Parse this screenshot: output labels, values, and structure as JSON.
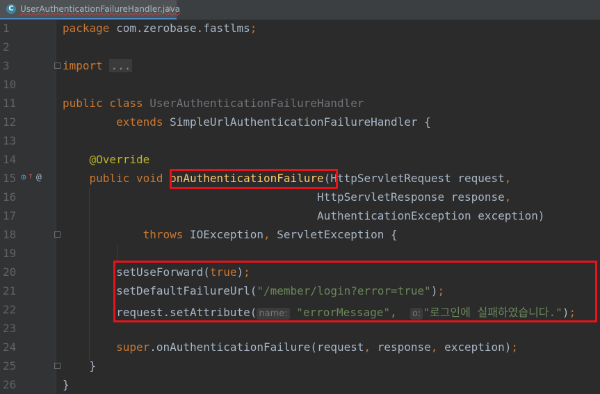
{
  "tab": {
    "icon_letter": "C",
    "title": "UserAuthenticationFailureHandler.java"
  },
  "lines": [
    {
      "num": "1",
      "tokens": [
        [
          "kw",
          "package "
        ],
        [
          "",
          "com.zerobase.fastlms"
        ],
        [
          "kw",
          ";"
        ]
      ]
    },
    {
      "num": "2",
      "tokens": []
    },
    {
      "num": "3",
      "tokens": [
        [
          "kw",
          "import "
        ],
        [
          "fold",
          "..."
        ]
      ]
    },
    {
      "num": "10",
      "tokens": []
    },
    {
      "num": "11",
      "tokens": [
        [
          "kw",
          "public class "
        ],
        [
          "gray",
          "UserAuthenticationFailureHandler"
        ]
      ]
    },
    {
      "num": "12",
      "tokens": [
        [
          "kw",
          "        extends "
        ],
        [
          "",
          "SimpleUrlAuthenticationFailureHandler {"
        ]
      ]
    },
    {
      "num": "13",
      "tokens": []
    },
    {
      "num": "14",
      "tokens": [
        [
          "ann",
          "    @Override"
        ]
      ]
    },
    {
      "num": "15",
      "tokens": [
        [
          "kw",
          "    public void "
        ],
        [
          "meth",
          "onAuthenticationFailure"
        ],
        [
          "",
          "(HttpServletRequest request"
        ],
        [
          "kw",
          ","
        ]
      ]
    },
    {
      "num": "16",
      "tokens": [
        [
          "",
          "                                      HttpServletResponse response"
        ],
        [
          "kw",
          ","
        ]
      ]
    },
    {
      "num": "17",
      "tokens": [
        [
          "",
          "                                      AuthenticationException exception)"
        ]
      ]
    },
    {
      "num": "18",
      "tokens": [
        [
          "kw",
          "            throws "
        ],
        [
          "",
          "IOException"
        ],
        [
          "kw",
          ", "
        ],
        [
          "",
          "ServletException {"
        ]
      ]
    },
    {
      "num": "19",
      "tokens": []
    },
    {
      "num": "20",
      "tokens": [
        [
          "",
          "        setUseForward("
        ],
        [
          "kw",
          "true"
        ],
        [
          "",
          ")"
        ],
        [
          "kw",
          ";"
        ]
      ]
    },
    {
      "num": "21",
      "tokens": [
        [
          "",
          "        setDefaultFailureUrl("
        ],
        [
          "str",
          "\"/member/login?error=true\""
        ],
        [
          "",
          ")"
        ],
        [
          "kw",
          ";"
        ]
      ]
    },
    {
      "num": "22",
      "tokens": [
        [
          "",
          "        request.setAttribute("
        ],
        [
          "hint",
          "name:"
        ],
        [
          "",
          " "
        ],
        [
          "str",
          "\"errorMessage\""
        ],
        [
          "kw",
          ",  "
        ],
        [
          "hint",
          "o:"
        ],
        [
          "str",
          "\"로그인에 실패하였습니다.\""
        ],
        [
          "",
          ")"
        ],
        [
          "kw",
          ";"
        ]
      ]
    },
    {
      "num": "23",
      "tokens": []
    },
    {
      "num": "24",
      "tokens": [
        [
          "kw",
          "        super"
        ],
        [
          "",
          ".onAuthenticationFailure(request"
        ],
        [
          "kw",
          ", "
        ],
        [
          "",
          "response"
        ],
        [
          "kw",
          ", "
        ],
        [
          "",
          "exception)"
        ],
        [
          "kw",
          ";"
        ]
      ]
    },
    {
      "num": "25",
      "tokens": [
        [
          "",
          "    }"
        ]
      ]
    },
    {
      "num": "26",
      "tokens": [
        [
          "",
          "}"
        ]
      ]
    }
  ],
  "gutter_icons": {
    "override_icon": "override-implementation-icon",
    "annotation_icon": "@"
  },
  "colors": {
    "highlight_box": "#e8121b",
    "keyword": "#cc7832",
    "string": "#6a8759",
    "method": "#ffc66d",
    "annotation": "#bbb529"
  }
}
